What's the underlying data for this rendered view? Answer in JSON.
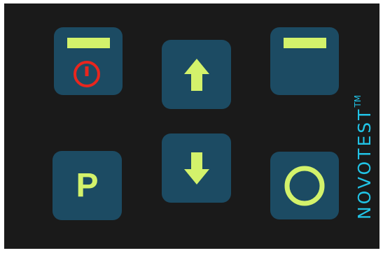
{
  "device_panel": {
    "buttons": {
      "power": {
        "icon": "power-icon",
        "indicator": "status-bar"
      },
      "up": {
        "icon": "arrow-up-icon"
      },
      "menu": {
        "indicator": "status-bar"
      },
      "print": {
        "label": "P"
      },
      "down": {
        "icon": "arrow-down-icon"
      },
      "ok": {
        "icon": "circle-icon"
      }
    },
    "brand": {
      "name": "NOVOTEST",
      "mark": "TM"
    }
  },
  "colors": {
    "panel_bg": "#1a1a1a",
    "key_bg": "#1c4b63",
    "accent_green": "#d3f26b",
    "power_red": "#e8261e",
    "brand_cyan": "#21c3e6"
  }
}
